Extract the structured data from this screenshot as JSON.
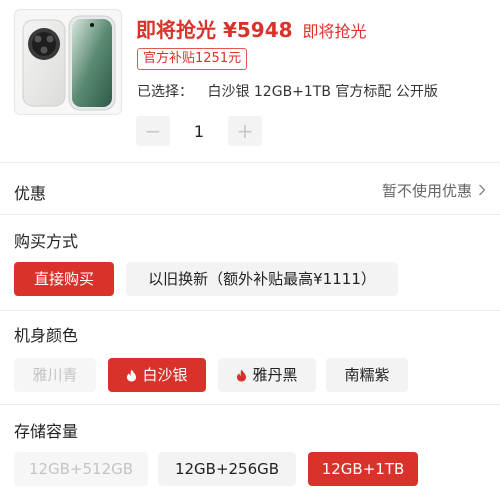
{
  "product": {
    "price_label": "即将抢光 ¥5948",
    "price_note": "即将抢光",
    "subsidy_badge": "官方补贴1251元",
    "selected_prefix": "已选择：",
    "selected_value": "白沙银 12GB+1TB 官方标配 公开版",
    "thumbnail_icon": "phone-product-image"
  },
  "quantity": {
    "minus_label": "−",
    "value": "1",
    "plus_label": "+"
  },
  "promo": {
    "title": "优惠",
    "value": "暂不使用优惠"
  },
  "purchase_method": {
    "title": "购买方式",
    "options": [
      {
        "label": "直接购买",
        "state": "selected"
      },
      {
        "label": "以旧换新（额外补贴最高¥1111）",
        "state": "normal"
      }
    ]
  },
  "color": {
    "title": "机身颜色",
    "options": [
      {
        "label": "雅川青",
        "state": "disabled",
        "hot": false
      },
      {
        "label": "白沙银",
        "state": "selected",
        "hot": true
      },
      {
        "label": "雅丹黑",
        "state": "normal",
        "hot": true
      },
      {
        "label": "南糯紫",
        "state": "normal",
        "hot": false
      }
    ]
  },
  "storage": {
    "title": "存储容量",
    "options": [
      {
        "label": "12GB+512GB",
        "state": "disabled"
      },
      {
        "label": "12GB+256GB",
        "state": "normal"
      },
      {
        "label": "12GB+1TB",
        "state": "selected"
      }
    ]
  },
  "colors": {
    "accent": "#d8322b",
    "chip_bg": "#f3f3f3",
    "disabled_text": "#c4c4c4"
  }
}
